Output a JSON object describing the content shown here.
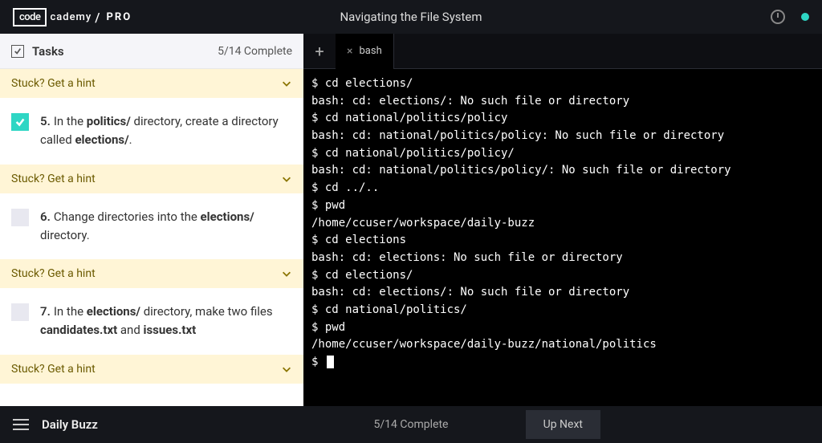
{
  "header": {
    "logo_box": "code",
    "logo_text": "cademy",
    "logo_sep": "/",
    "logo_pro": "PRO",
    "lesson_title": "Navigating the File System"
  },
  "tasks": {
    "title": "Tasks",
    "progress": "5/14 Complete",
    "hint_label": "Stuck? Get a hint",
    "items": [
      {
        "num": "5.",
        "done": true,
        "html": "In the <b>politics/</b> directory, create a directory called <b>elections/</b>."
      },
      {
        "num": "6.",
        "done": false,
        "html": "Change directories into the <b>elections/</b> directory."
      },
      {
        "num": "7.",
        "done": false,
        "html": "In the <b>elections/</b> directory, make two files <b>candidates.txt</b> and <b>issues.txt</b>"
      }
    ]
  },
  "terminal": {
    "tab": "bash",
    "lines": [
      "$ cd elections/",
      "bash: cd: elections/: No such file or directory",
      "$ cd national/politics/policy",
      "bash: cd: national/politics/policy: No such file or directory",
      "$ cd national/politics/policy/",
      "bash: cd: national/politics/policy/: No such file or directory",
      "$ cd ../..",
      "$ pwd",
      "/home/ccuser/workspace/daily-buzz",
      "$ cd elections",
      "bash: cd: elections: No such file or directory",
      "$ cd elections/",
      "bash: cd: elections/: No such file or directory",
      "$ cd national/politics/",
      "$ pwd",
      "/home/ccuser/workspace/daily-buzz/national/politics"
    ],
    "prompt": "$"
  },
  "footer": {
    "project": "Daily Buzz",
    "progress": "5/14 Complete",
    "upnext": "Up Next"
  }
}
